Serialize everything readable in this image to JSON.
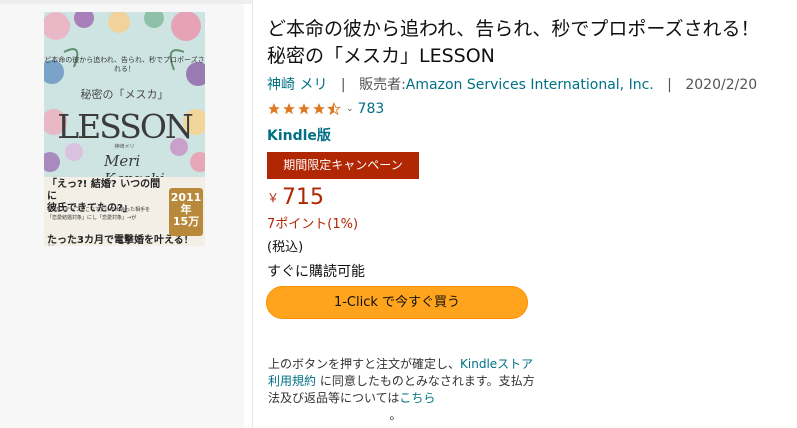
{
  "book": {
    "title_line1": "ど本命の彼から追われ、告られ、秒でプロポーズされる！",
    "title_line2": "秘密の「メスカ」LESSON",
    "author": "神崎 メリ",
    "seller_prefix": "販売者:",
    "seller": "Amazon Services International, Inc.",
    "date": "2020/2/20",
    "rating_stars": 4.5,
    "rating_count": "783",
    "format": "Kindle版",
    "deal_label": "期間限定キャンペーン",
    "price_symbol": "￥",
    "price": "715",
    "points": "7ポイント(1%)",
    "tax_note": "(税込)",
    "availability": "すぐに購読可能",
    "buy_button": "1-Click で今すぐ買う"
  },
  "cover": {
    "tagline": "ど本命の彼から追われ、告られ、秒でプロポーズされる！",
    "subtitle": "秘密の「メスカ」",
    "title": "LESSON",
    "author_small": "神崎メリ",
    "signature": "Meri Kanzaki",
    "band_headline1": "「えっ?! 結婚? いつの間に",
    "band_headline2": "彼氏できてたの?」",
    "band_small1": "4つのステップをこなすだけで出会った相手を",
    "band_small2": "「恋愛結婚対象」にし「恋愛対象」→が",
    "band_headline3": "たった3カ月で電撃婚を叶える！",
    "band_foot": "メリ",
    "badge_line1": "2011年",
    "badge_line2": "15万"
  },
  "terms": {
    "part1": "上のボタンを押すと注文が確定し、",
    "link1": "Kindleストア利用規約",
    "part2": " に同意したものとみなされます。支払方法及び返品等については",
    "link2": "こちら",
    "end": "。"
  },
  "colors": {
    "link": "#007185",
    "price": "#b12704",
    "deal_bg": "#b12704",
    "button": "#ffa41c",
    "star": "#de7921"
  }
}
